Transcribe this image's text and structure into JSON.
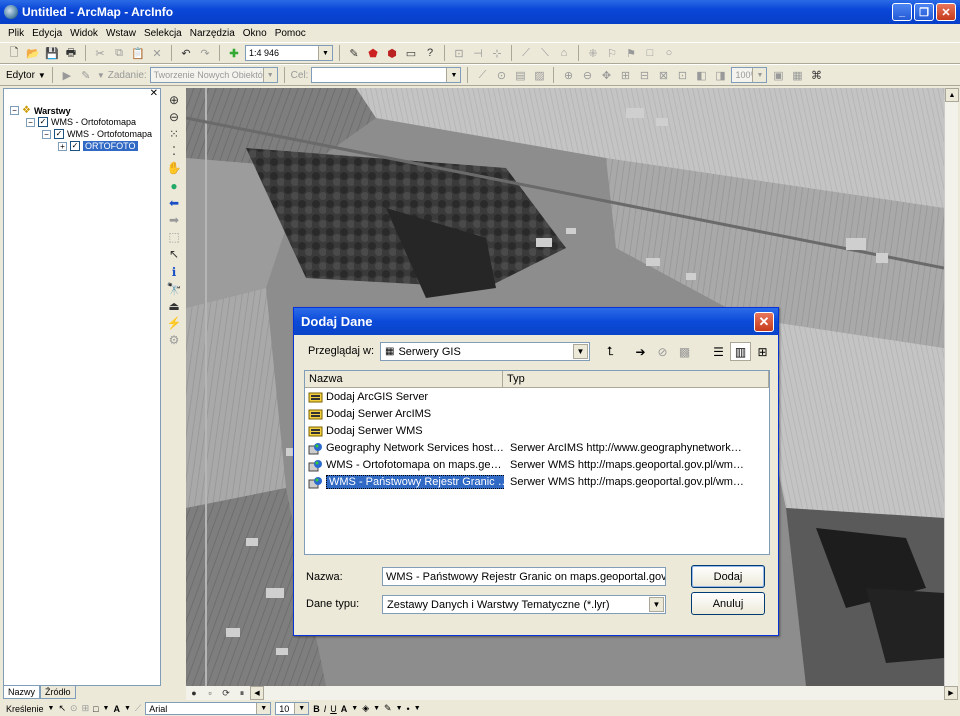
{
  "window": {
    "title": "Untitled - ArcMap - ArcInfo"
  },
  "menu": [
    "Plik",
    "Edycja",
    "Widok",
    "Wstaw",
    "Selekcja",
    "Narzędzia",
    "Okno",
    "Pomoc"
  ],
  "toolbar1": {
    "scale": "1:4 946"
  },
  "toolbar2": {
    "editor_label": "Edytor",
    "task_label": "Zadanie:",
    "task_value": "Tworzenie Nowych Obiektów",
    "target_label": "Cel:",
    "target_value": "",
    "zoom_value": "100%"
  },
  "toc": {
    "root": "Warstwy",
    "layers": [
      {
        "label": "WMS - Ortofotomapa"
      },
      {
        "label": "WMS - Ortofotomapa"
      },
      {
        "label": "ORTOFOTO"
      }
    ],
    "tabs": [
      "Nazwy",
      "Źródło"
    ]
  },
  "drawing": {
    "label": "Kreślenie",
    "font": "Arial",
    "size": "10"
  },
  "dialog": {
    "title": "Dodaj Dane",
    "look_in_label": "Przeglądaj w:",
    "look_in_value": "Serwery GIS",
    "columns": [
      "Nazwa",
      "Typ"
    ],
    "items": [
      {
        "name": "Dodaj ArcGIS Server",
        "type": "",
        "icon": "add-server-icon"
      },
      {
        "name": "Dodaj Serwer ArcIMS",
        "type": "",
        "icon": "add-server-icon"
      },
      {
        "name": "Dodaj Serwer WMS",
        "type": "",
        "icon": "add-server-icon"
      },
      {
        "name": "Geography Network Services host…",
        "type": "Serwer ArcIMS  http://www.geographynetwork…",
        "icon": "globe-server-icon"
      },
      {
        "name": "WMS - Ortofotomapa on maps.ge…",
        "type": "Serwer WMS  http://maps.geoportal.gov.pl/wm…",
        "icon": "globe-server-icon"
      },
      {
        "name": "WMS - Państwowy Rejestr Granic …",
        "type": "Serwer WMS  http://maps.geoportal.gov.pl/wm…",
        "icon": "globe-server-icon"
      }
    ],
    "name_label": "Nazwa:",
    "name_value": "WMS - Państwowy Rejestr Granic on maps.geoportal.gov.pl",
    "type_label": "Dane typu:",
    "type_value": "Zestawy Danych i Warstwy Tematyczne (*.lyr)",
    "add_button": "Dodaj",
    "cancel_button": "Anuluj"
  }
}
